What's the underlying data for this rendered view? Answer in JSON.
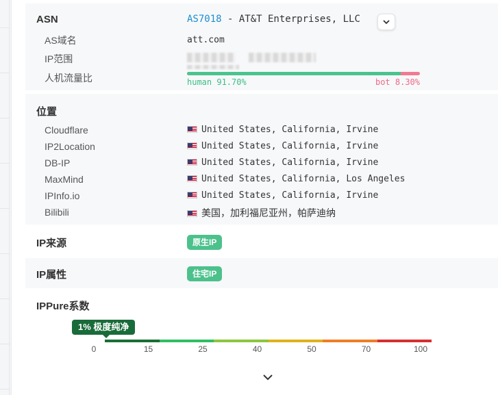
{
  "asn": {
    "title": "ASN",
    "number": "AS7018",
    "name": " - AT&T Enterprises, LLC",
    "rows": [
      {
        "label": "AS域名",
        "value": "att.com"
      },
      {
        "label": "IP范围",
        "value": ""
      },
      {
        "label": "人机流量比",
        "value": ""
      }
    ],
    "traffic": {
      "human_fraction": 0.917,
      "human_label": "human 91.70%",
      "bot_label": "bot 8.30%"
    }
  },
  "location": {
    "title": "位置",
    "rows": [
      {
        "label": "Cloudflare",
        "value": "United States, California, Irvine"
      },
      {
        "label": "IP2Location",
        "value": "United States, California, Irvine"
      },
      {
        "label": "DB-IP",
        "value": "United States, California, Irvine"
      },
      {
        "label": "MaxMind",
        "value": "United States, California, Los Angeles"
      },
      {
        "label": "IPInfo.io",
        "value": "United States, California, Irvine"
      },
      {
        "label": "Bilibili",
        "value": "美国，加利福尼亚州，帕萨迪纳"
      }
    ]
  },
  "ip_source": {
    "title": "IP来源",
    "tag": "原生IP"
  },
  "ip_type": {
    "title": "IP属性",
    "tag": "住宅IP"
  },
  "ippure": {
    "title": "IPPure系数",
    "score_label": "1% 极度纯净",
    "score": 1,
    "ticks": [
      "0",
      "15",
      "25",
      "40",
      "50",
      "70",
      "100"
    ],
    "colors": [
      "#1b6e35",
      "#2fbf63",
      "#8cc63f",
      "#e0b21b",
      "#ef7d25",
      "#d62f2f"
    ]
  },
  "icons": {
    "dropdown": "chevron-down-icon",
    "expand": "chevron-down-icon",
    "flag": "us-flag-icon"
  }
}
